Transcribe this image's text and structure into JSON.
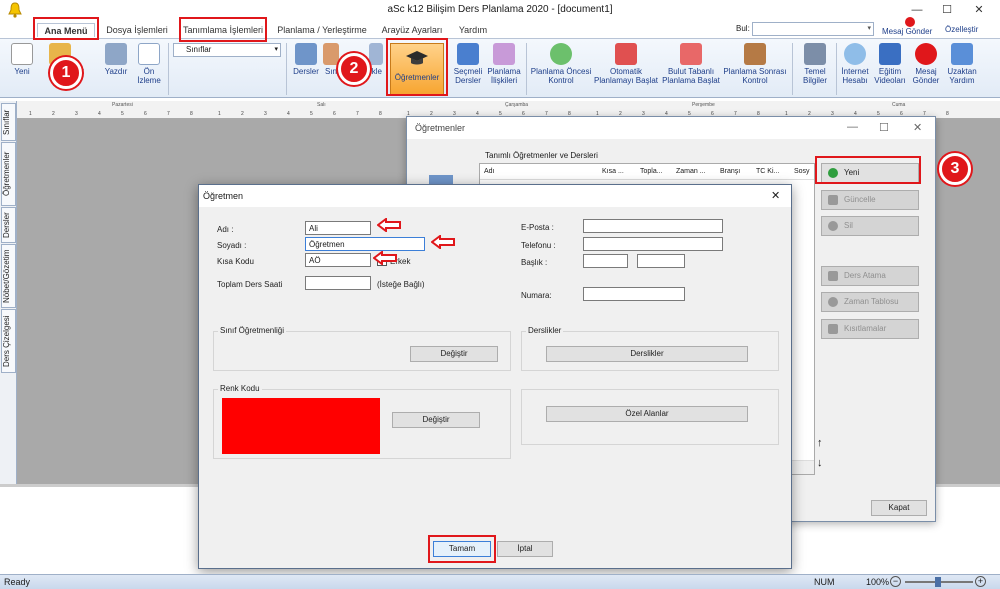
{
  "window": {
    "title": "aSc k12 Bilişim Ders Planlama 2020  - [document1]",
    "minimize": "—",
    "maximize": "☐",
    "close": "✕"
  },
  "tabs": [
    {
      "label": "Ana Menü"
    },
    {
      "label": "Dosya İşlemleri"
    },
    {
      "label": "Tanımlama İşlemleri"
    },
    {
      "label": "Planlama / Yerleştirme"
    },
    {
      "label": "Arayüz Ayarları"
    },
    {
      "label": "Yardım"
    }
  ],
  "header_right": {
    "bul_label": "Bul:",
    "message_send": "Mesaj Gönder",
    "customize": "Özelleştir"
  },
  "ribbon": {
    "new": "Yeni",
    "save": "dedet",
    "print": "Yazdır",
    "preview": "Ön İzleme",
    "class_select": "Sınıflar",
    "lessons": "Dersler",
    "classes": "Sın",
    "classrooms": "ikle",
    "teachers": "Öğretmenler",
    "elective": "Seçmeli Dersler",
    "planning_rel": "Planlama İlişkileri",
    "pre_check": "Planlama Öncesi Kontrol",
    "auto_place": "Otomatik Planlamayı Başlat",
    "cloud_place": "Bulut Tabanlı Planlama Başlat",
    "post_check": "Planlama Sonrası Kontrol",
    "basic_info": "Temel Bilgiler",
    "internet_account": "İnternet Hesabı",
    "edu_videos": "Eğitim Videoları",
    "msg_send": "Mesaj Gönder",
    "remote_help": "Uzaktan Yardım"
  },
  "ruler": {
    "days": [
      "Pazartesi",
      "Salı",
      "Çarşamba",
      "Perşembe",
      "Cuma"
    ],
    "numbers": [
      "1",
      "2",
      "3",
      "4",
      "5",
      "6",
      "7",
      "8"
    ]
  },
  "left_tabs": [
    "Sınıflar",
    "Öğretmenler",
    "Dersler",
    "Nöbet/Gözetim",
    "Ders Çizelgesi"
  ],
  "teachers_window": {
    "title": "Öğretmenler",
    "group_label": "Tanımlı Öğretmenler ve Dersleri",
    "columns": [
      "Adı",
      "Kısa ...",
      "Topla...",
      "Zaman ...",
      "Branşı",
      "TC Ki...",
      "Sosy"
    ],
    "buttons": {
      "new": "Yeni",
      "update": "Güncelle",
      "delete": "Sil",
      "assign": "Ders Atama",
      "time_table": "Zaman Tablosu",
      "constraints": "Kısıtlamalar",
      "close": "Kapat"
    }
  },
  "dialog": {
    "title": "Öğretmen",
    "labels": {
      "name": "Adı :",
      "surname": "Soyadı :",
      "short_code": "Kısa Kodu",
      "total_hours": "Toplam Ders Saati",
      "optional": "(İsteğe Bağlı)",
      "gender": "Erkek",
      "email": "E-Posta :",
      "phone": "Telefonu :",
      "title": "Başlık :",
      "number": "Numara:"
    },
    "values": {
      "name": "Ali",
      "surname": "Öğretmen",
      "short_code": "AÖ",
      "total_hours": ""
    },
    "groups": {
      "homeroom": "Sınıf Öğretmenliği",
      "lessons": "Derslikler",
      "color": "Renk Kodu"
    },
    "buttons": {
      "change1": "Değiştir",
      "lessons_btn": "Derslikler",
      "change2": "Değiştir",
      "special": "Özel Alanlar",
      "ok": "Tamam",
      "cancel": "İptal"
    },
    "color_code": "#ff0000"
  },
  "annotations": {
    "one": "1",
    "two": "2",
    "three": "3"
  },
  "status": {
    "left": "Ready",
    "num": "NUM",
    "zoom": "100%"
  }
}
